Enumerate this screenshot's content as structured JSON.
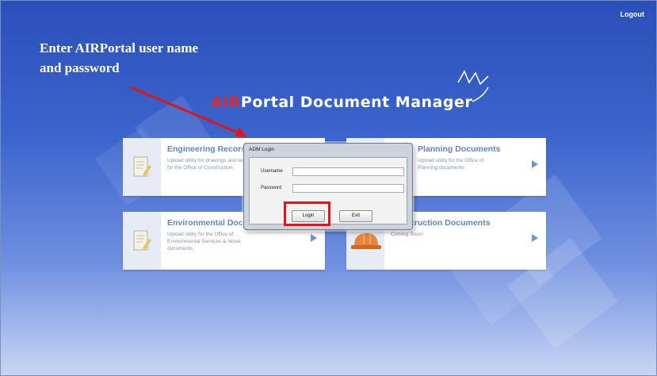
{
  "header": {
    "logout_label": "Logout"
  },
  "annotation": {
    "line1": "Enter AIRPortal user name",
    "line2": "and password",
    "color": "#e01616"
  },
  "title": {
    "accent": "AIR",
    "rest": "Portal Document Manager",
    "accent_color": "#e02a2a"
  },
  "tiles": [
    {
      "title": "Engineering Records",
      "description": "Upload utility for drawings and reports for the Office of Construction.",
      "icon": "document-edit-icon"
    },
    {
      "title": "Planning Documents",
      "description": "Upload utility for the Office of Planning documents.",
      "icon": "document-icon"
    },
    {
      "title": "Environmental Documents",
      "description": "Upload utility for the Office of Environmental Services & Noise documents.",
      "icon": "document-edit-icon"
    },
    {
      "title": "Construction Documents",
      "description": "Coming Soon!",
      "icon": "hard-hat-icon"
    }
  ],
  "dialog": {
    "title": "ADM Login",
    "username_label": "Username",
    "username_value": "",
    "password_label": "Password",
    "password_value": "",
    "login_label": "Login",
    "exit_label": "Exit"
  },
  "colors": {
    "background_top": "#2b4fb8",
    "background_bottom": "#c9d6f4",
    "tile_title": "#5f83c9",
    "highlight": "#e01616"
  }
}
